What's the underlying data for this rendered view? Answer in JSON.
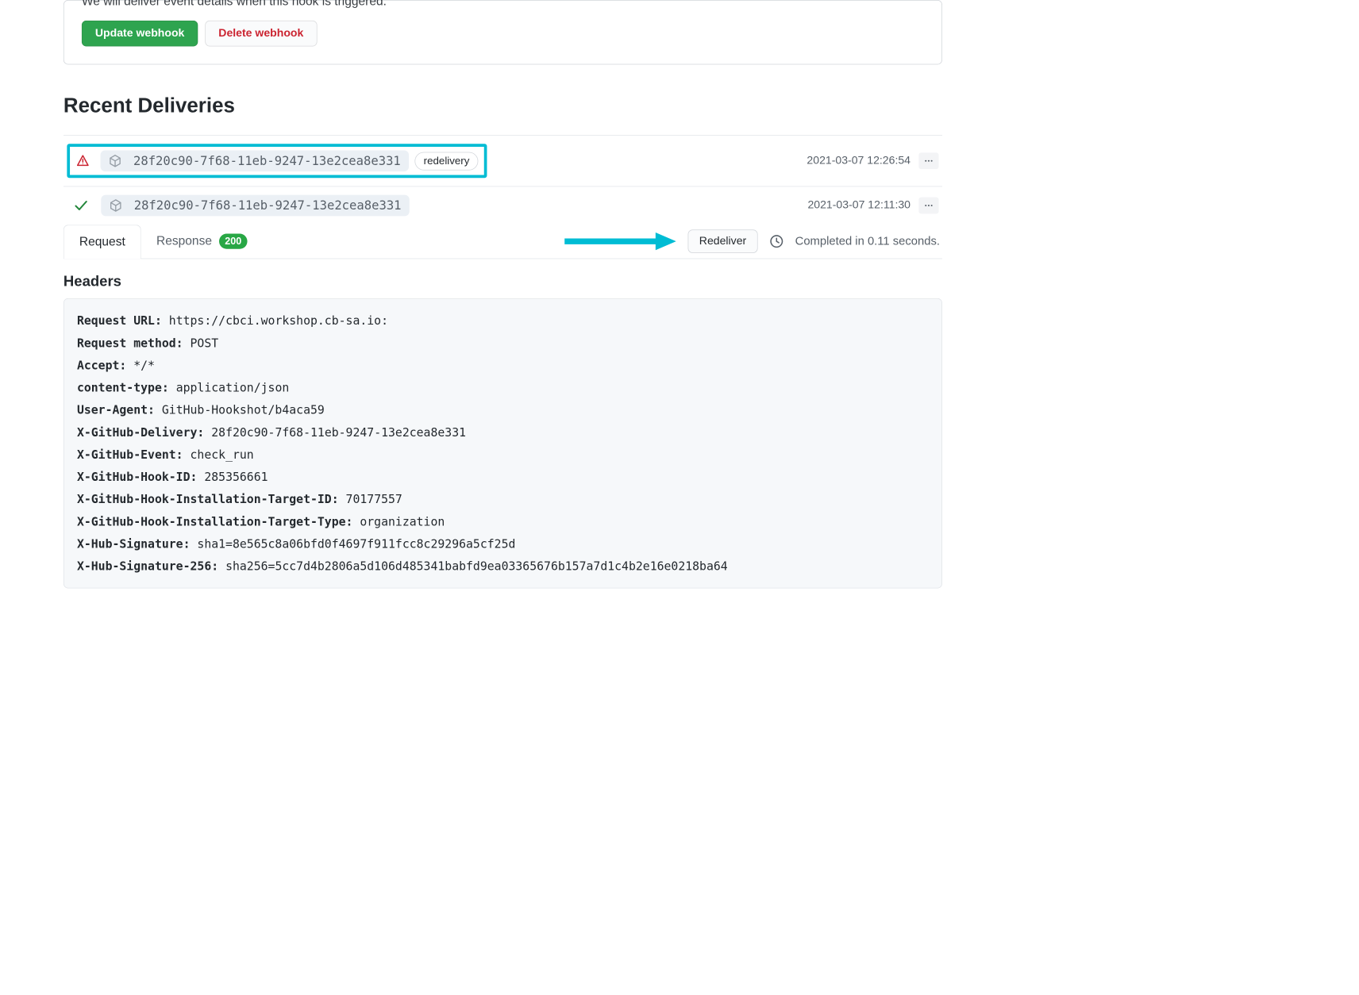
{
  "top_note": "We will deliver event details when this hook is triggered.",
  "buttons": {
    "update": "Update webhook",
    "delete": "Delete webhook",
    "redeliver": "Redeliver"
  },
  "section_title": "Recent Deliveries",
  "deliveries": [
    {
      "id": "28f20c90-7f68-11eb-9247-13e2cea8e331",
      "redelivery_label": "redelivery",
      "timestamp": "2021-03-07 12:26:54"
    },
    {
      "id": "28f20c90-7f68-11eb-9247-13e2cea8e331",
      "timestamp": "2021-03-07 12:11:30"
    }
  ],
  "tabs": {
    "request": "Request",
    "response": "Response",
    "response_status": "200"
  },
  "completed_text": "Completed in 0.11 seconds.",
  "headers_title": "Headers",
  "headers": {
    "request_url_k": "Request URL:",
    "request_url_v": "https://cbci.workshop.cb-sa.io:",
    "request_method_k": "Request method:",
    "request_method_v": "POST",
    "accept_k": "Accept:",
    "accept_v": "*/*",
    "content_type_k": "content-type:",
    "content_type_v": "application/json",
    "user_agent_k": "User-Agent:",
    "user_agent_v": "GitHub-Hookshot/b4aca59",
    "gh_delivery_k": "X-GitHub-Delivery:",
    "gh_delivery_v": "28f20c90-7f68-11eb-9247-13e2cea8e331",
    "gh_event_k": "X-GitHub-Event:",
    "gh_event_v": "check_run",
    "gh_hook_id_k": "X-GitHub-Hook-ID:",
    "gh_hook_id_v": "285356661",
    "gh_install_id_k": "X-GitHub-Hook-Installation-Target-ID:",
    "gh_install_id_v": "70177557",
    "gh_install_type_k": "X-GitHub-Hook-Installation-Target-Type:",
    "gh_install_type_v": "organization",
    "hub_sig_k": "X-Hub-Signature:",
    "hub_sig_v": "sha1=8e565c8a06bfd0f4697f911fcc8c29296a5cf25d",
    "hub_sig256_k": "X-Hub-Signature-256:",
    "hub_sig256_v": "sha256=5cc7d4b2806a5d106d485341babfd9ea03365676b157a7d1c4b2e16e0218ba64"
  }
}
